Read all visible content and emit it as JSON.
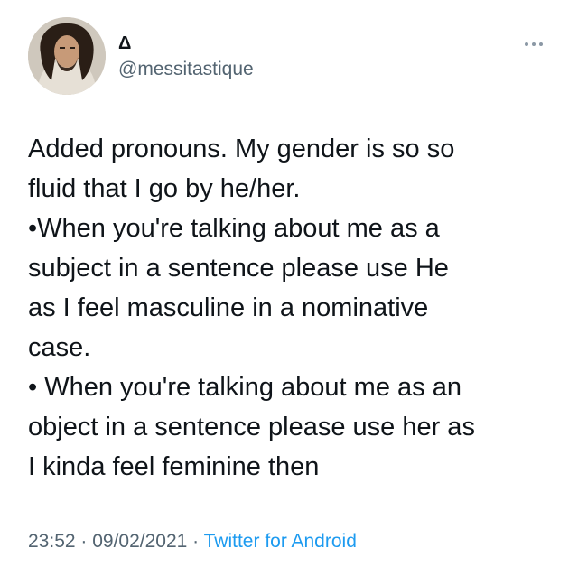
{
  "author": {
    "display_name": "Δ",
    "handle": "@messitastique"
  },
  "menu_icon": "more-dots-icon",
  "body_lines": [
    "Added pronouns. My gender is so so",
    "fluid that I go by he/her.",
    "•When you're talking about me as a",
    "subject in a sentence please use He",
    "as I feel masculine in a nominative",
    "case.",
    "• When you're talking about me as an",
    "object in a sentence please use her as",
    "I kinda feel feminine then"
  ],
  "meta": {
    "time": "23:52",
    "separator": " · ",
    "date": "09/02/2021",
    "source": "Twitter for Android"
  },
  "colors": {
    "text": "#0f1419",
    "secondary": "#536471",
    "link": "#1d9bf0"
  }
}
